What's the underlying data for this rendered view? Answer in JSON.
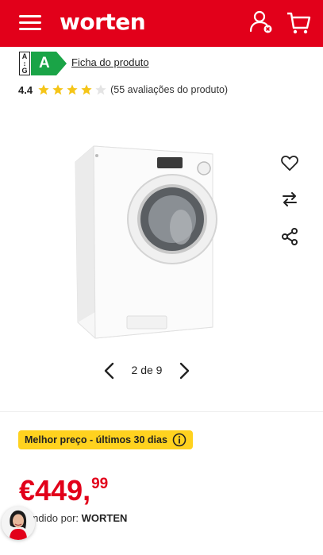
{
  "header": {
    "brand": "worten",
    "bg_color": "#e2001a",
    "menu_icon": "hamburger-menu-icon",
    "user_icon": "user-account-icon",
    "cart_icon": "shopping-cart-icon"
  },
  "energy_label": {
    "scale_letters": [
      "A",
      "↕",
      "G"
    ],
    "class": "A",
    "class_color": "#1aa447",
    "fiche_link": "Ficha do produto"
  },
  "rating": {
    "value": "4.4",
    "stars_filled": 4,
    "stars_total": 5,
    "star_color": "#f5c518",
    "count_text": "(55 avaliações do produto)"
  },
  "product": {
    "image": "washing-machine-image",
    "actions": [
      "heart-favorite-icon",
      "compare-arrows-icon",
      "share-icon"
    ]
  },
  "pager": {
    "text": "2 de 9",
    "current": 2,
    "total": 9
  },
  "best_price": {
    "label": "Melhor preço - últimos 30 dias",
    "bg_color": "#ffd21f",
    "info_icon": "info-icon"
  },
  "price": {
    "main": "€449,",
    "cents": "99",
    "color": "#e2001a"
  },
  "seller": {
    "prefix": "Vendido por:",
    "name": "WORTEN"
  },
  "chat": {
    "avatar": "assistant-avatar"
  }
}
